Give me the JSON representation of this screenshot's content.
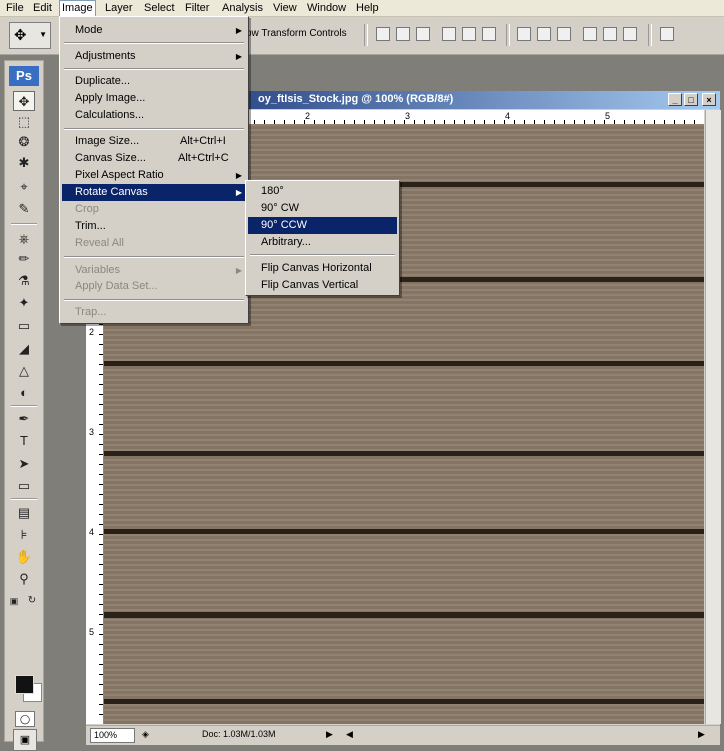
{
  "menubar": {
    "items": [
      "File",
      "Edit",
      "Image",
      "Layer",
      "Select",
      "Filter",
      "Analysis",
      "View",
      "Window",
      "Help"
    ],
    "active": "Image"
  },
  "options_bar": {
    "show_transform_controls": "ow Transform Controls"
  },
  "toolbox": {
    "logo": "Ps"
  },
  "document": {
    "title": "oy_ftIsis_Stock.jpg @ 100% (RGB/8#)",
    "ruler_h": [
      "2",
      "3",
      "4",
      "5"
    ],
    "ruler_v": [
      "2",
      "3",
      "4",
      "5"
    ],
    "zoom": "100%",
    "doc_info": "Doc: 1.03M/1.03M",
    "window_buttons": [
      "_",
      "□",
      "×"
    ]
  },
  "image_menu": {
    "items": [
      {
        "label": "Mode",
        "shortcut": "",
        "submenu": true,
        "disabled": false
      },
      {
        "label": "Adjustments",
        "shortcut": "",
        "submenu": true,
        "disabled": false
      },
      {
        "label": "Duplicate...",
        "shortcut": "",
        "submenu": false,
        "disabled": false
      },
      {
        "label": "Apply Image...",
        "shortcut": "",
        "submenu": false,
        "disabled": false
      },
      {
        "label": "Calculations...",
        "shortcut": "",
        "submenu": false,
        "disabled": false
      },
      {
        "label": "Image Size...",
        "shortcut": "Alt+Ctrl+I",
        "submenu": false,
        "disabled": false
      },
      {
        "label": "Canvas Size...",
        "shortcut": "Alt+Ctrl+C",
        "submenu": false,
        "disabled": false
      },
      {
        "label": "Pixel Aspect Ratio",
        "shortcut": "",
        "submenu": true,
        "disabled": false
      },
      {
        "label": "Rotate Canvas",
        "shortcut": "",
        "submenu": true,
        "disabled": false,
        "highlighted": true
      },
      {
        "label": "Crop",
        "shortcut": "",
        "submenu": false,
        "disabled": true
      },
      {
        "label": "Trim...",
        "shortcut": "",
        "submenu": false,
        "disabled": false
      },
      {
        "label": "Reveal All",
        "shortcut": "",
        "submenu": false,
        "disabled": true
      },
      {
        "label": "Variables",
        "shortcut": "",
        "submenu": true,
        "disabled": true
      },
      {
        "label": "Apply Data Set...",
        "shortcut": "",
        "submenu": false,
        "disabled": true
      },
      {
        "label": "Trap...",
        "shortcut": "",
        "submenu": false,
        "disabled": true
      }
    ]
  },
  "rotate_submenu": {
    "items": [
      {
        "label": "180°",
        "highlighted": false
      },
      {
        "label": "90° CW",
        "highlighted": false
      },
      {
        "label": "90° CCW",
        "highlighted": true
      },
      {
        "label": "Arbitrary...",
        "highlighted": false
      },
      {
        "label": "Flip Canvas Horizontal",
        "highlighted": false
      },
      {
        "label": "Flip Canvas Vertical",
        "highlighted": false
      }
    ]
  },
  "colors": {
    "menu_highlight": "#0a246a",
    "foreground": "#121212",
    "background": "#ffffff",
    "title_gradient_start": "#0a246a",
    "title_gradient_end": "#a6caf0"
  }
}
